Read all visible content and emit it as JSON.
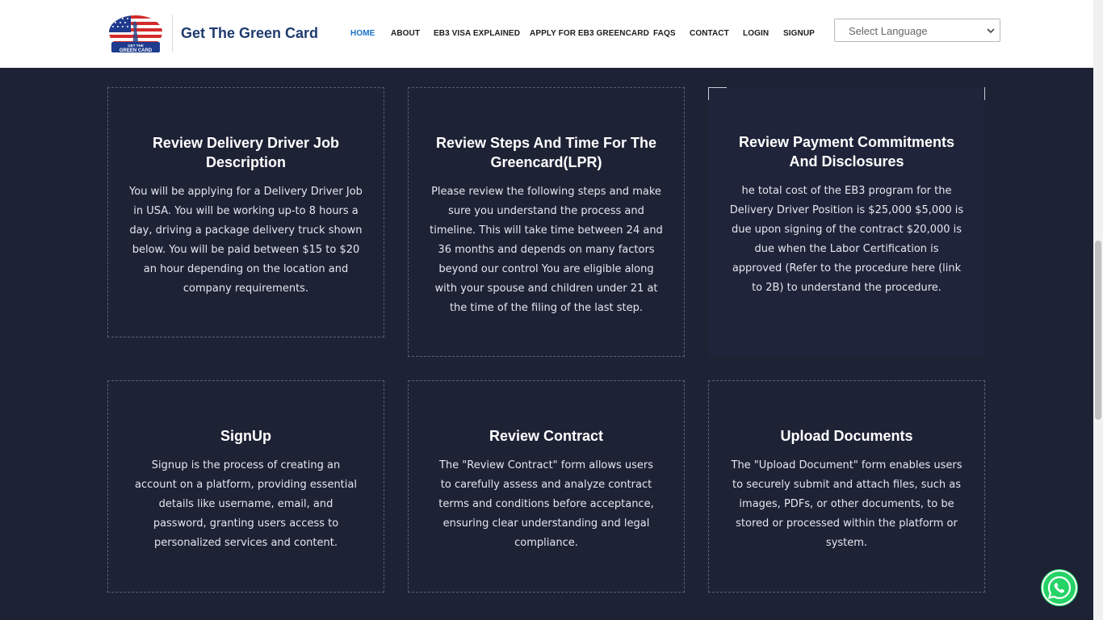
{
  "header": {
    "brand": "Get The Green Card",
    "logo_text_top": "GET THE",
    "logo_text_bottom": "GREEN CARD",
    "nav": [
      {
        "label": "HOME",
        "active": true
      },
      {
        "label": "ABOUT"
      },
      {
        "label": "EB3 VISA EXPLAINED"
      },
      {
        "label": "APPLY FOR EB3 GREENCARD"
      },
      {
        "label": "FAQS"
      },
      {
        "label": "CONTACT"
      },
      {
        "label": "LOGIN"
      },
      {
        "label": "SIGNUP"
      }
    ],
    "language_select": "Select Language"
  },
  "cards": [
    {
      "title": "Review Delivery Driver Job Description",
      "text": "You will be applying for a Delivery Driver Job in USA. You will be working up-to 8 hours a day, driving a package delivery truck shown below. You will be paid between $15 to $20 an hour depending on the location and company requirements."
    },
    {
      "title": "Review Steps And Time For The Greencard(LPR)",
      "text": "Please review the following steps and make sure you understand the process and timeline. This will take time between 24 and 36 months and depends on many factors beyond our control You are eligible along with your spouse and children under 21 at the time of the filing of the last step."
    },
    {
      "title": "Review Payment Commitments And Disclosures",
      "text": "he total cost of the EB3 program for the Delivery Driver Position is $25,000 $5,000 is due upon signing of the contract $20,000 is due when the Labor Certification is approved (Refer to the procedure here (link to 2B) to understand the procedure."
    },
    {
      "title": "SignUp",
      "text": "Signup is the process of creating an account on a platform, providing essential details like username, email, and password, granting users access to personalized services and content."
    },
    {
      "title": "Review Contract",
      "text": "The \"Review Contract\" form allows users to carefully assess and analyze contract terms and conditions before acceptance, ensuring clear understanding and legal compliance."
    },
    {
      "title": "Upload Documents",
      "text": "The \"Upload Document\" form enables users to securely submit and attach files, such as images, PDFs, or other documents, to be stored or processed within the platform or system."
    }
  ],
  "colors": {
    "background": "#1e2235",
    "brand": "#1f3b6e",
    "nav_active": "#1a73c8",
    "whatsapp": "#25d366"
  },
  "icons": {
    "whatsapp": "whatsapp-icon",
    "chevron": "chevron-down-icon"
  }
}
